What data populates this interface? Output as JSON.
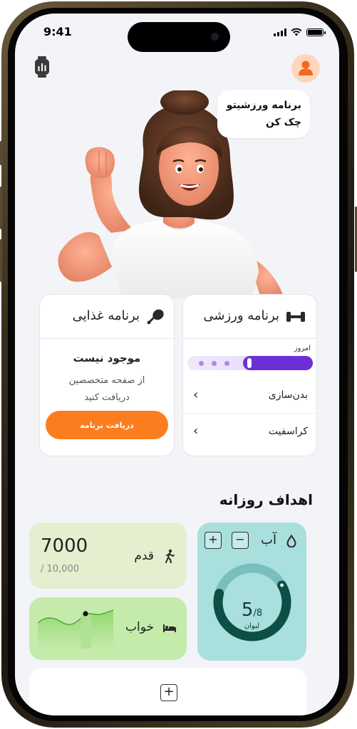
{
  "status_bar": {
    "time": "9:41"
  },
  "header": {
    "watch_icon": "smartwatch-icon",
    "avatar_icon": "user-icon"
  },
  "hero": {
    "speech_bubble": {
      "line1": "برنامه ورزشیتو",
      "line2": "چک کن"
    }
  },
  "workout_card": {
    "title": "برنامه ورزشی",
    "icon": "dumbbell-icon",
    "today_label": "امروز",
    "items": [
      {
        "label": "بدن‌سازی"
      },
      {
        "label": "کراسفیت"
      }
    ]
  },
  "diet_card": {
    "title": "برنامه غذایی",
    "icon": "drumstick-icon",
    "status": "موجود نیست",
    "message_line1": "از صفحه متخصصین",
    "message_line2": "دریافت کنید",
    "button_label": "دریافت برنامه"
  },
  "daily_goals": {
    "title": "اهداف روزانه",
    "steps": {
      "label": "قدم",
      "value": "7000",
      "goal": "/ 10,000"
    },
    "sleep": {
      "label": "خواب"
    },
    "water": {
      "label": "آب",
      "plus": "+",
      "minus": "−",
      "current": "5",
      "total": "/8",
      "unit": "لیوان"
    },
    "add_card": {
      "plus": "+"
    }
  },
  "colors": {
    "accent_orange": "#fb7d20",
    "accent_purple": "#6c2fd5",
    "water_bg": "#a9dfdd",
    "steps_bg": "#e3efcf",
    "sleep_bg": "#c5ebab"
  }
}
